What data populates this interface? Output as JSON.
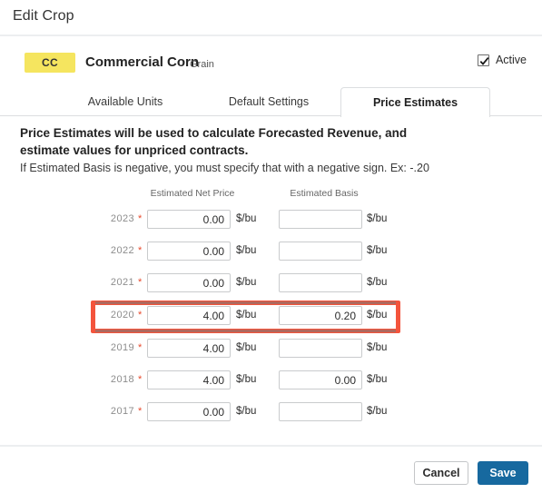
{
  "dialog": {
    "title": "Edit Crop"
  },
  "crop": {
    "badge": "CC",
    "name": "Commercial Corn",
    "type": "Grain",
    "active_label": "Active",
    "active_checked": true,
    "check_icon": "check-icon"
  },
  "tabs": [
    {
      "label": "Available Units",
      "active": false
    },
    {
      "label": "Default Settings",
      "active": false
    },
    {
      "label": "Price Estimates",
      "active": true
    }
  ],
  "description": {
    "main": "Price Estimates will be used to calculate Forecasted Revenue, and estimate values for unpriced contracts.",
    "sub": "If Estimated Basis is negative, you must specify that with a negative sign. Ex: -.20"
  },
  "table": {
    "columns": [
      "Estimated Net Price",
      "Estimated Basis"
    ],
    "unit": "$/bu",
    "required_marker": "*",
    "rows": [
      {
        "year": "2023",
        "net_price": "0.00",
        "basis": "",
        "highlighted": false
      },
      {
        "year": "2022",
        "net_price": "0.00",
        "basis": "",
        "highlighted": false
      },
      {
        "year": "2021",
        "net_price": "0.00",
        "basis": "",
        "highlighted": false
      },
      {
        "year": "2020",
        "net_price": "4.00",
        "basis": "0.20",
        "highlighted": true
      },
      {
        "year": "2019",
        "net_price": "4.00",
        "basis": "",
        "highlighted": false
      },
      {
        "year": "2018",
        "net_price": "4.00",
        "basis": "0.00",
        "highlighted": false
      },
      {
        "year": "2017",
        "net_price": "0.00",
        "basis": "",
        "highlighted": false
      }
    ]
  },
  "footer": {
    "cancel_label": "Cancel",
    "save_label": "Save"
  },
  "colors": {
    "badge_yellow": "#f5e55f",
    "save_blue": "#17699f",
    "highlight_red": "#f4543c",
    "required_red": "#e8492b"
  }
}
